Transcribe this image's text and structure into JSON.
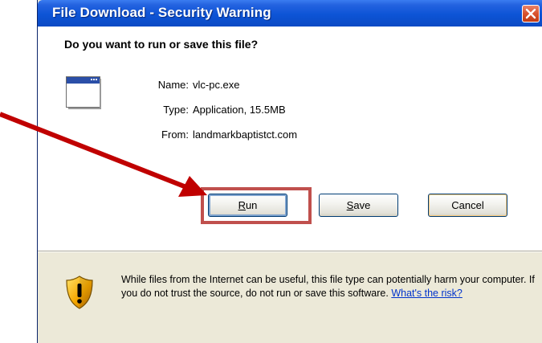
{
  "window": {
    "title": "File Download - Security Warning"
  },
  "dialog": {
    "question": "Do you want to run or save this file?",
    "file_icon": "application-window-icon",
    "fields": [
      {
        "label": "Name:",
        "value": "vlc-pc.exe"
      },
      {
        "label": "Type:",
        "value": "Application, 15.5MB"
      },
      {
        "label": "From:",
        "value": "landmarkbaptistct.com"
      }
    ],
    "buttons": {
      "run": {
        "label_accel": "R",
        "label_rest": "un"
      },
      "save": {
        "label_accel": "S",
        "label_rest": "ave"
      },
      "cancel": {
        "label": "Cancel"
      }
    },
    "warning": {
      "icon": "shield-warning-icon",
      "text": "While files from the Internet can be useful, this file type can potentially harm your computer. If you do not trust the source, do not run or save this software.",
      "link": "What's the risk?"
    }
  },
  "annotation": {
    "arrow_color": "#c00000",
    "highlight_color": "#c0504d"
  },
  "colors": {
    "titlebar": "#0b4ac4",
    "dialog_bg": "#ece9d8",
    "link": "#0033cc"
  }
}
